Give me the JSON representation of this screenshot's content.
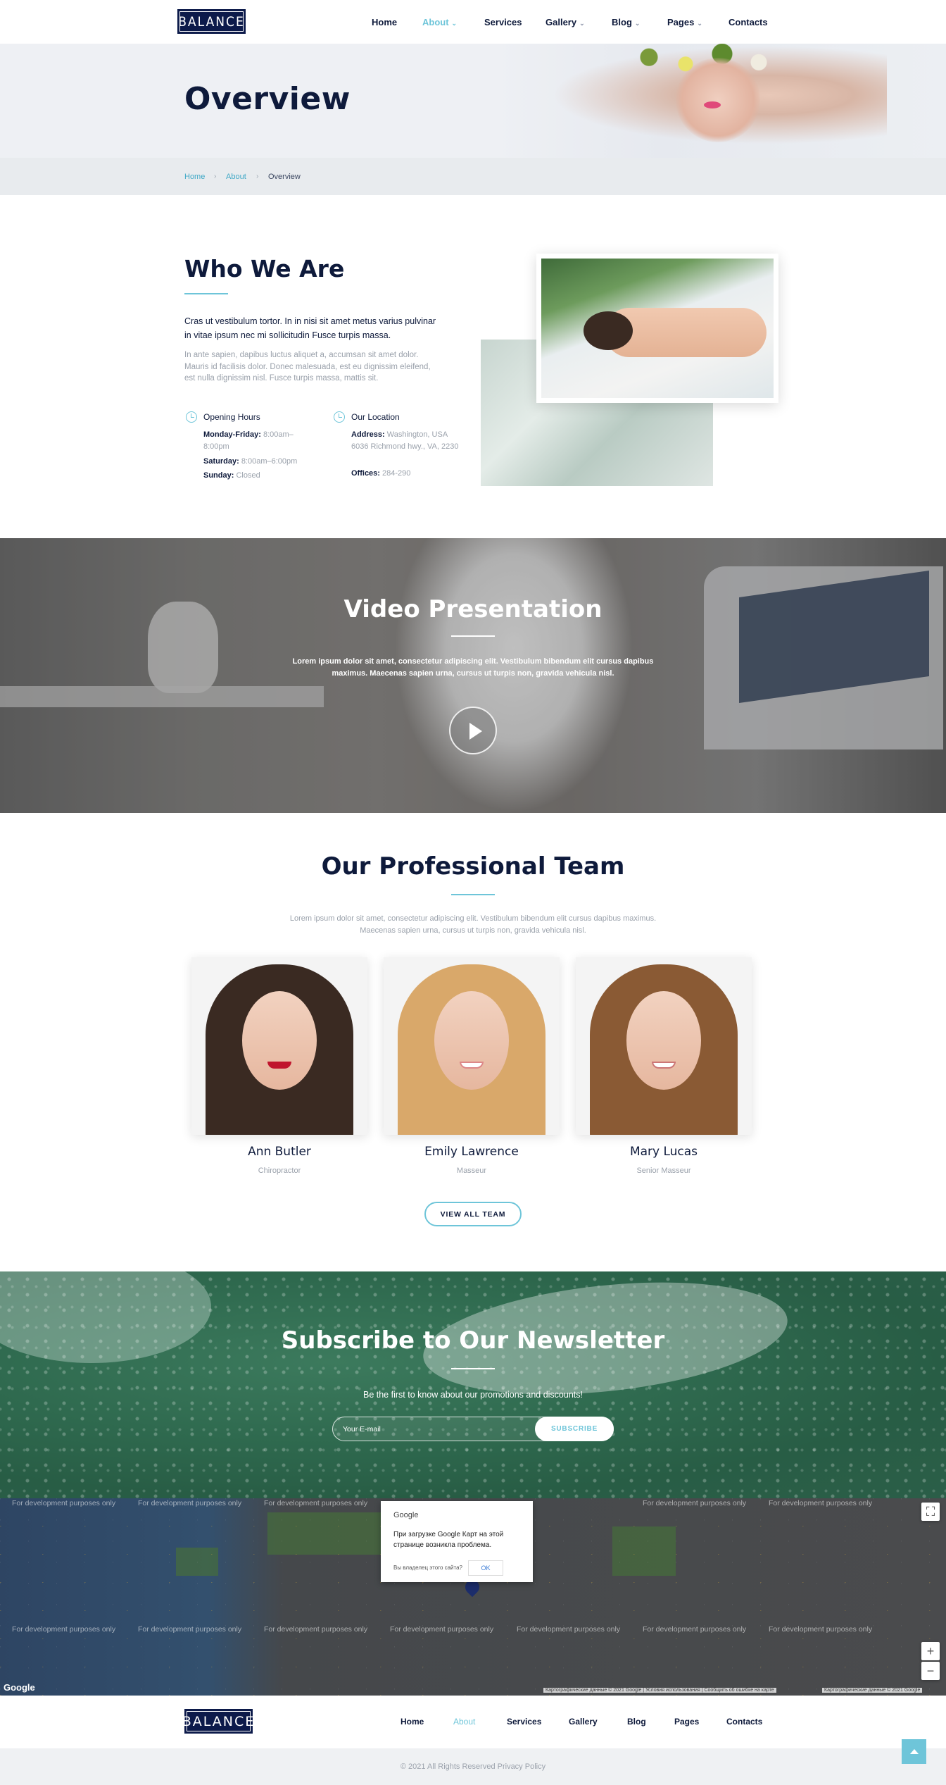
{
  "brand": {
    "logo_text": "BALANCE"
  },
  "header": {
    "nav": [
      {
        "label": "Home",
        "has_dropdown": false,
        "active": false
      },
      {
        "label": "About",
        "has_dropdown": true,
        "active": true
      },
      {
        "label": "Services",
        "has_dropdown": false,
        "active": false
      },
      {
        "label": "Gallery",
        "has_dropdown": true,
        "active": false
      },
      {
        "label": "Blog",
        "has_dropdown": true,
        "active": false
      },
      {
        "label": "Pages",
        "has_dropdown": true,
        "active": false
      },
      {
        "label": "Contacts",
        "has_dropdown": false,
        "active": false
      }
    ]
  },
  "page": {
    "title": "Overview",
    "breadcrumb": [
      "Home",
      "About",
      "Overview"
    ]
  },
  "who": {
    "heading": "Who We Are",
    "lead": "Cras ut vestibulum tortor. In in nisi sit amet metus varius pulvinar in vitae ipsum nec mi sollicitudin Fusce turpis massa.",
    "body": "In ante sapien, dapibus luctus aliquet a, accumsan sit amet dolor. Mauris id facilisis dolor. Donec malesuada, est eu dignissim eleifend, est nulla dignissim nisl. Fusce turpis massa, mattis sit.",
    "hours": {
      "heading": "Opening Hours",
      "rows": [
        {
          "label": "Monday-Friday:",
          "value": "8:00am–8:00pm"
        },
        {
          "label": "Saturday:",
          "value": "8:00am–6:00pm"
        },
        {
          "label": "Sunday:",
          "value": "Closed"
        }
      ]
    },
    "location": {
      "heading": "Our Location",
      "address_label": "Address:",
      "address_value": "Washington, USA 6036 Richmond hwy., VA, 2230",
      "offices_label": "Offices:",
      "offices_value": "284-290"
    }
  },
  "video": {
    "heading": "Video Presentation",
    "text": "Lorem ipsum dolor sit amet, consectetur adipiscing elit. Vestibulum bibendum elit cursus dapibus maximus. Maecenas sapien urna, cursus ut turpis non, gravida vehicula nisl."
  },
  "team": {
    "heading": "Our Professional Team",
    "text": "Lorem ipsum dolor sit amet, consectetur adipiscing elit. Vestibulum bibendum elit cursus dapibus maximus. Maecenas sapien urna, cursus ut turpis non, gravida vehicula nisl.",
    "members": [
      {
        "name": "Ann Butler",
        "role": "Chiropractor"
      },
      {
        "name": "Emily Lawrence",
        "role": "Masseur"
      },
      {
        "name": "Mary Lucas",
        "role": "Senior Masseur"
      }
    ],
    "button_label": "VIEW ALL TEAM"
  },
  "newsletter": {
    "heading": "Subscribe to Our Newsletter",
    "text": "Be the first to know about our promotions and discounts!",
    "email_placeholder": "Your E-mail",
    "button_label": "SUBSCRIBE"
  },
  "map": {
    "dev_label": "For development purposes only",
    "dialog_title": "Google",
    "dialog_message": "При загрузке Google Карт на этой странице возникла проблема.",
    "dialog_question": "Вы владелец этого сайта?",
    "dialog_ok": "OK",
    "logo": "Google",
    "zoom_in": "+",
    "zoom_out": "−",
    "fullscreen": "⛶",
    "attribution": "Картографические данные © 2021 Google | Условия использования | Сообщить об ошибке на карте",
    "attribution_right": "Картографические данные © 2021 Google"
  },
  "footer": {
    "nav": [
      "Home",
      "About",
      "Services",
      "Gallery",
      "Blog",
      "Pages",
      "Contacts"
    ],
    "copyright": "© 2021 All Rights Reserved Privacy Policy"
  },
  "colors": {
    "accent": "#6ec5d9",
    "navy": "#0e1a3b",
    "logo_bg": "#0c1a4a"
  }
}
